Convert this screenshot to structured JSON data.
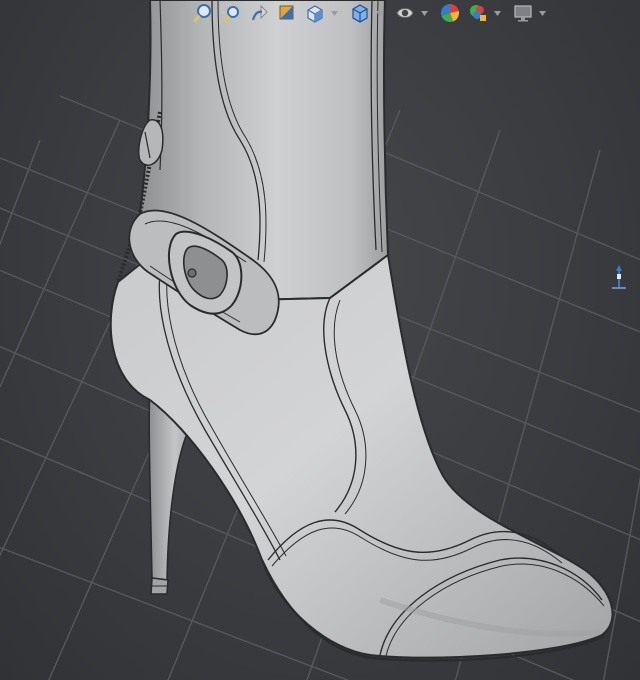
{
  "app": {
    "window_title": ""
  },
  "heads_up_toolbar": {
    "buttons": [
      {
        "id": "zoom-to-fit",
        "icon": "zoom-to-fit-icon"
      },
      {
        "id": "zoom-to-area",
        "icon": "zoom-to-area-icon"
      },
      {
        "id": "previous-view",
        "icon": "previous-view-icon"
      },
      {
        "id": "section-view",
        "icon": "section-view-icon"
      },
      {
        "id": "view-orientation",
        "icon": "view-orientation-icon",
        "has_menu": true
      },
      {
        "id": "display-style",
        "icon": "display-style-icon",
        "has_menu": true
      },
      {
        "id": "hide-show-items",
        "icon": "hide-show-items-icon",
        "has_menu": true
      },
      {
        "id": "edit-appearance",
        "icon": "edit-appearance-icon"
      },
      {
        "id": "apply-scene",
        "icon": "apply-scene-icon",
        "has_menu": true
      },
      {
        "id": "view-settings",
        "icon": "view-settings-icon",
        "has_menu": true
      }
    ]
  },
  "colors": {
    "viewport_background": "#3b3d40",
    "grid_line": "#55585c",
    "model_shade": "#b9babc",
    "edge_line": "#2a2b2d",
    "accent_blue": "#2f7fd1"
  },
  "viewport": {
    "model": "high-heel-boot",
    "display_mode": "shaded-with-edges",
    "grid": true
  }
}
